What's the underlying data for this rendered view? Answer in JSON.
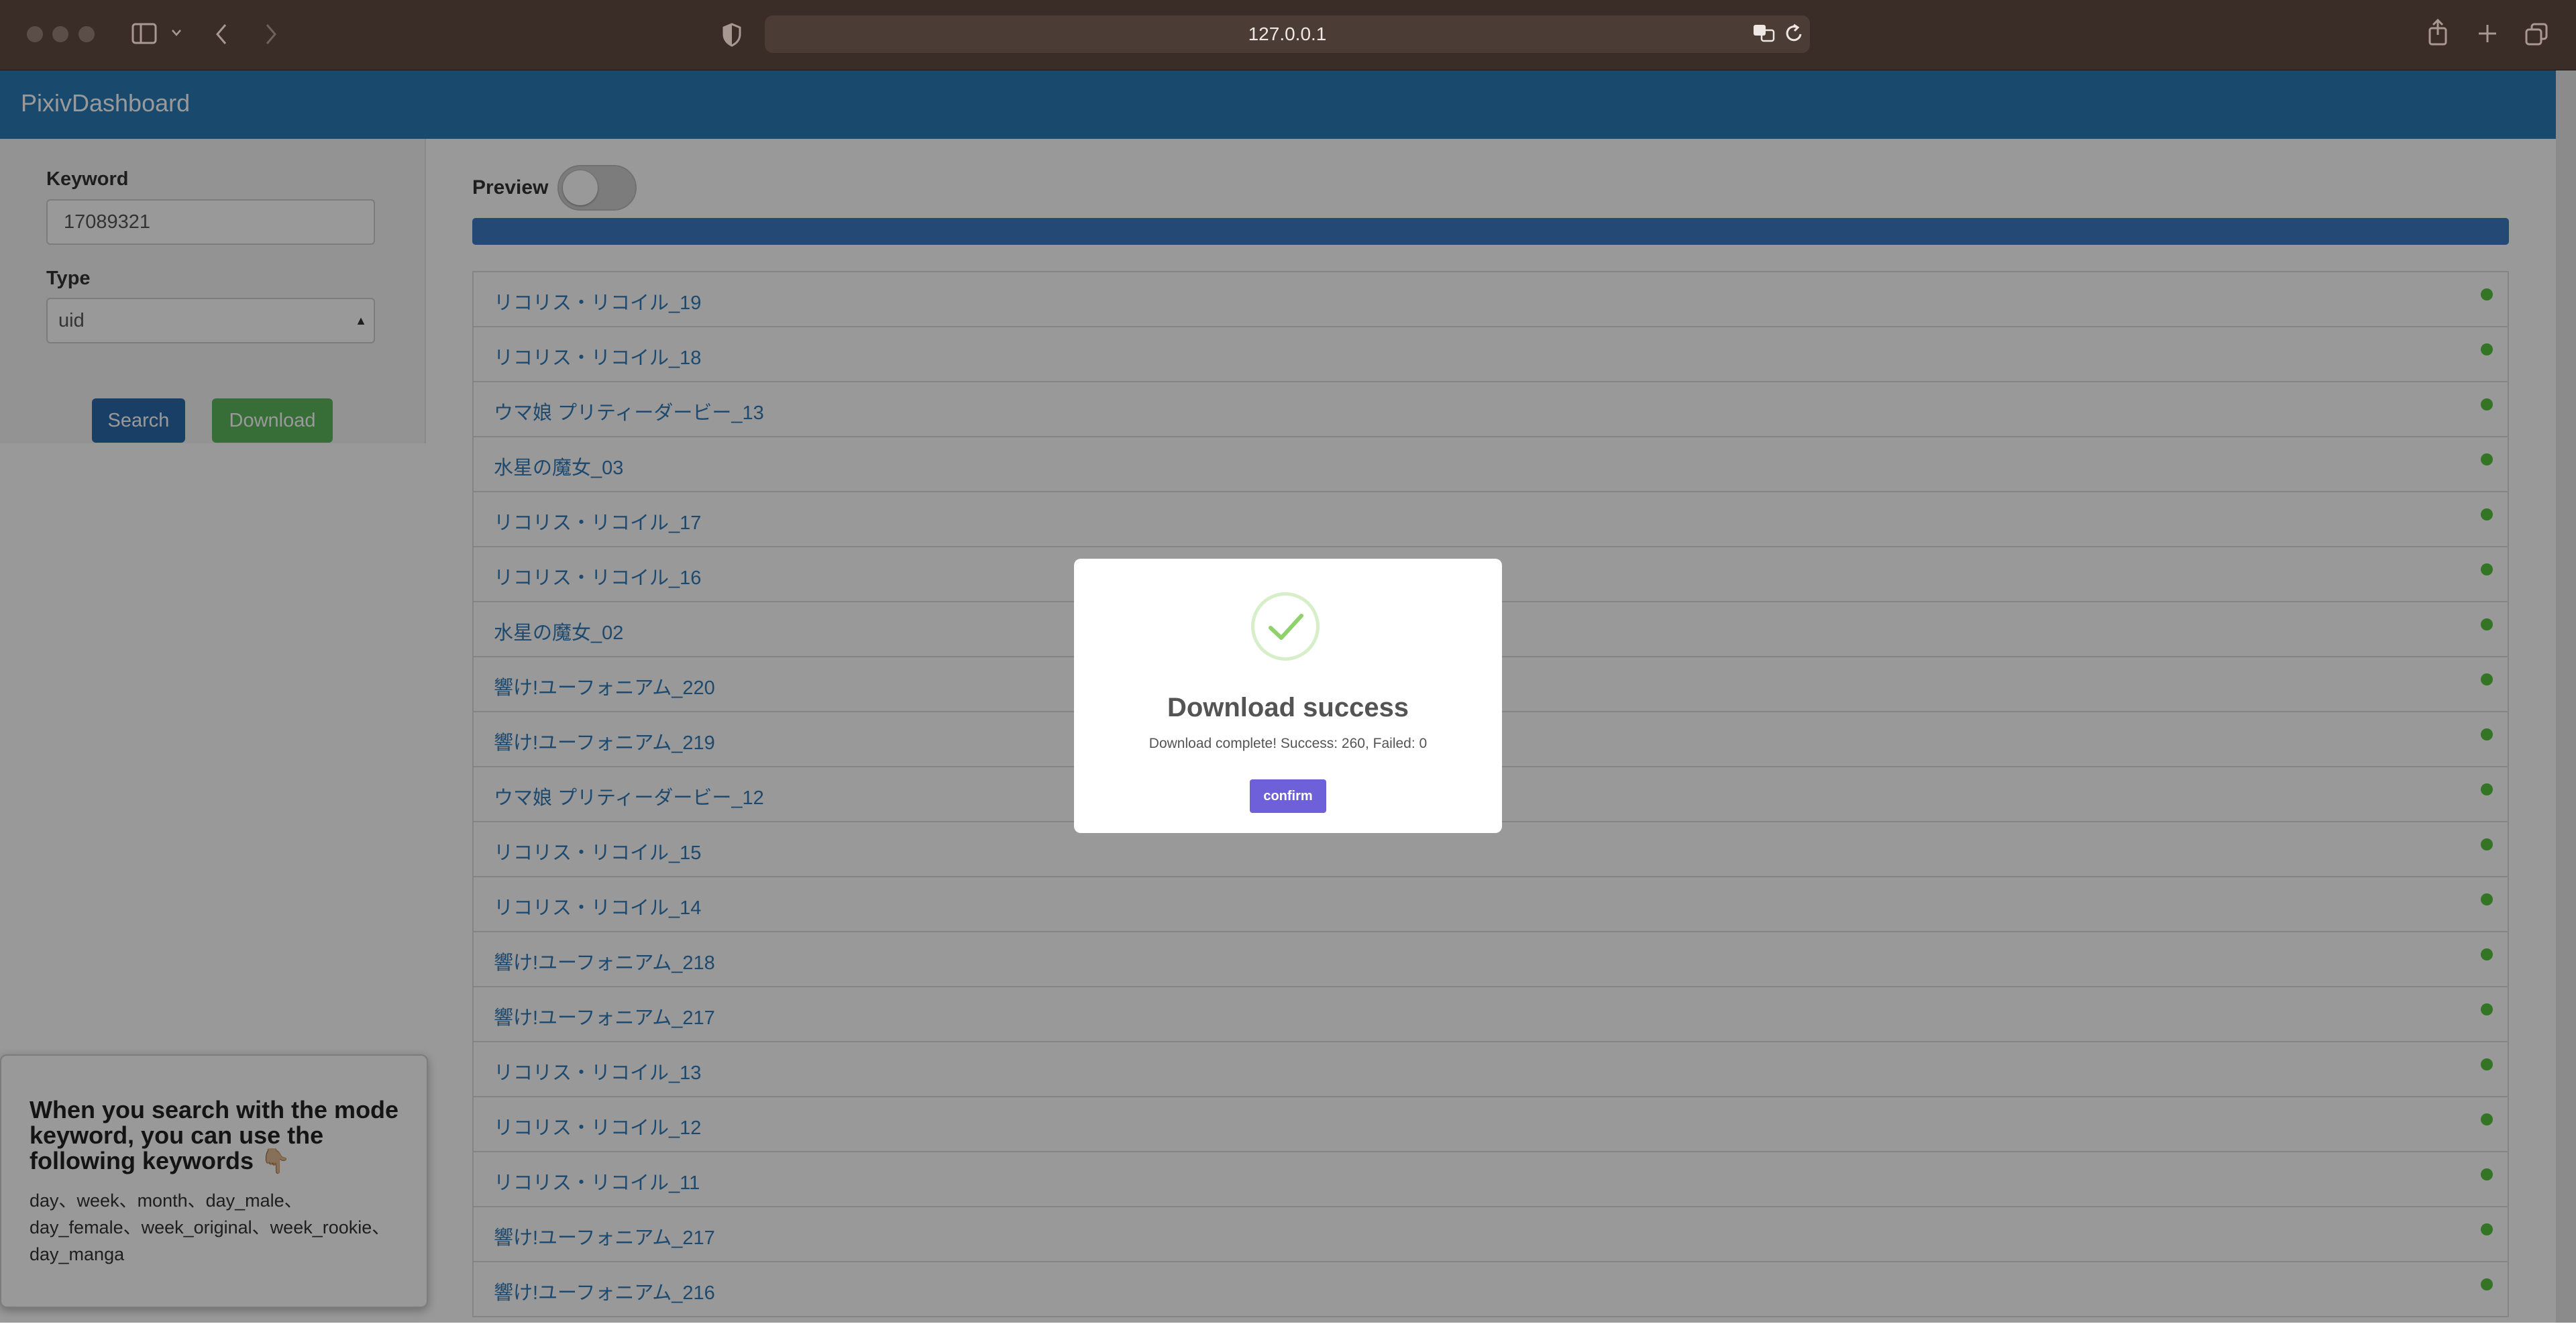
{
  "browser": {
    "url": "127.0.0.1"
  },
  "app": {
    "brand": "PixivDashboard"
  },
  "sidebar": {
    "keyword_label": "Keyword",
    "keyword_value": "17089321",
    "type_label": "Type",
    "type_value": "uid",
    "search_label": "Search",
    "download_label": "Download"
  },
  "tip": {
    "title": "When you search with the mode keyword, you can use the following keywords 👇🏼",
    "keywords": "day、week、month、day_male、day_female、week_original、week_rookie、day_manga"
  },
  "main": {
    "preview_label": "Preview",
    "preview_enabled": false,
    "progress_percent": 100,
    "results": [
      {
        "title": "リコリス・リコイル_19",
        "status": "done"
      },
      {
        "title": "リコリス・リコイル_18",
        "status": "done"
      },
      {
        "title": "ウマ娘 プリティーダービー_13",
        "status": "done"
      },
      {
        "title": "水星の魔女_03",
        "status": "done"
      },
      {
        "title": "リコリス・リコイル_17",
        "status": "done"
      },
      {
        "title": "リコリス・リコイル_16",
        "status": "done"
      },
      {
        "title": "水星の魔女_02",
        "status": "done"
      },
      {
        "title": "響け!ユーフォニアム_220",
        "status": "done"
      },
      {
        "title": "響け!ユーフォニアム_219",
        "status": "done"
      },
      {
        "title": "ウマ娘 プリティーダービー_12",
        "status": "done"
      },
      {
        "title": "リコリス・リコイル_15",
        "status": "done"
      },
      {
        "title": "リコリス・リコイル_14",
        "status": "done"
      },
      {
        "title": "響け!ユーフォニアム_218",
        "status": "done"
      },
      {
        "title": "響け!ユーフォニアム_217",
        "status": "done"
      },
      {
        "title": "リコリス・リコイル_13",
        "status": "done"
      },
      {
        "title": "リコリス・リコイル_12",
        "status": "done"
      },
      {
        "title": "リコリス・リコイル_11",
        "status": "done"
      },
      {
        "title": "響け!ユーフォニアム_217",
        "status": "done"
      },
      {
        "title": "響け!ユーフォニアム_216",
        "status": "done"
      }
    ]
  },
  "modal": {
    "icon": "checkmark-icon",
    "title": "Download success",
    "message": "Download complete! Success: 260, Failed: 0",
    "confirm_label": "confirm"
  },
  "colors": {
    "header": "#2a7ab6",
    "link": "#337ab7",
    "status_ok": "#55c23e",
    "confirm": "#6e60d8",
    "progress": "#3c7ac2"
  }
}
